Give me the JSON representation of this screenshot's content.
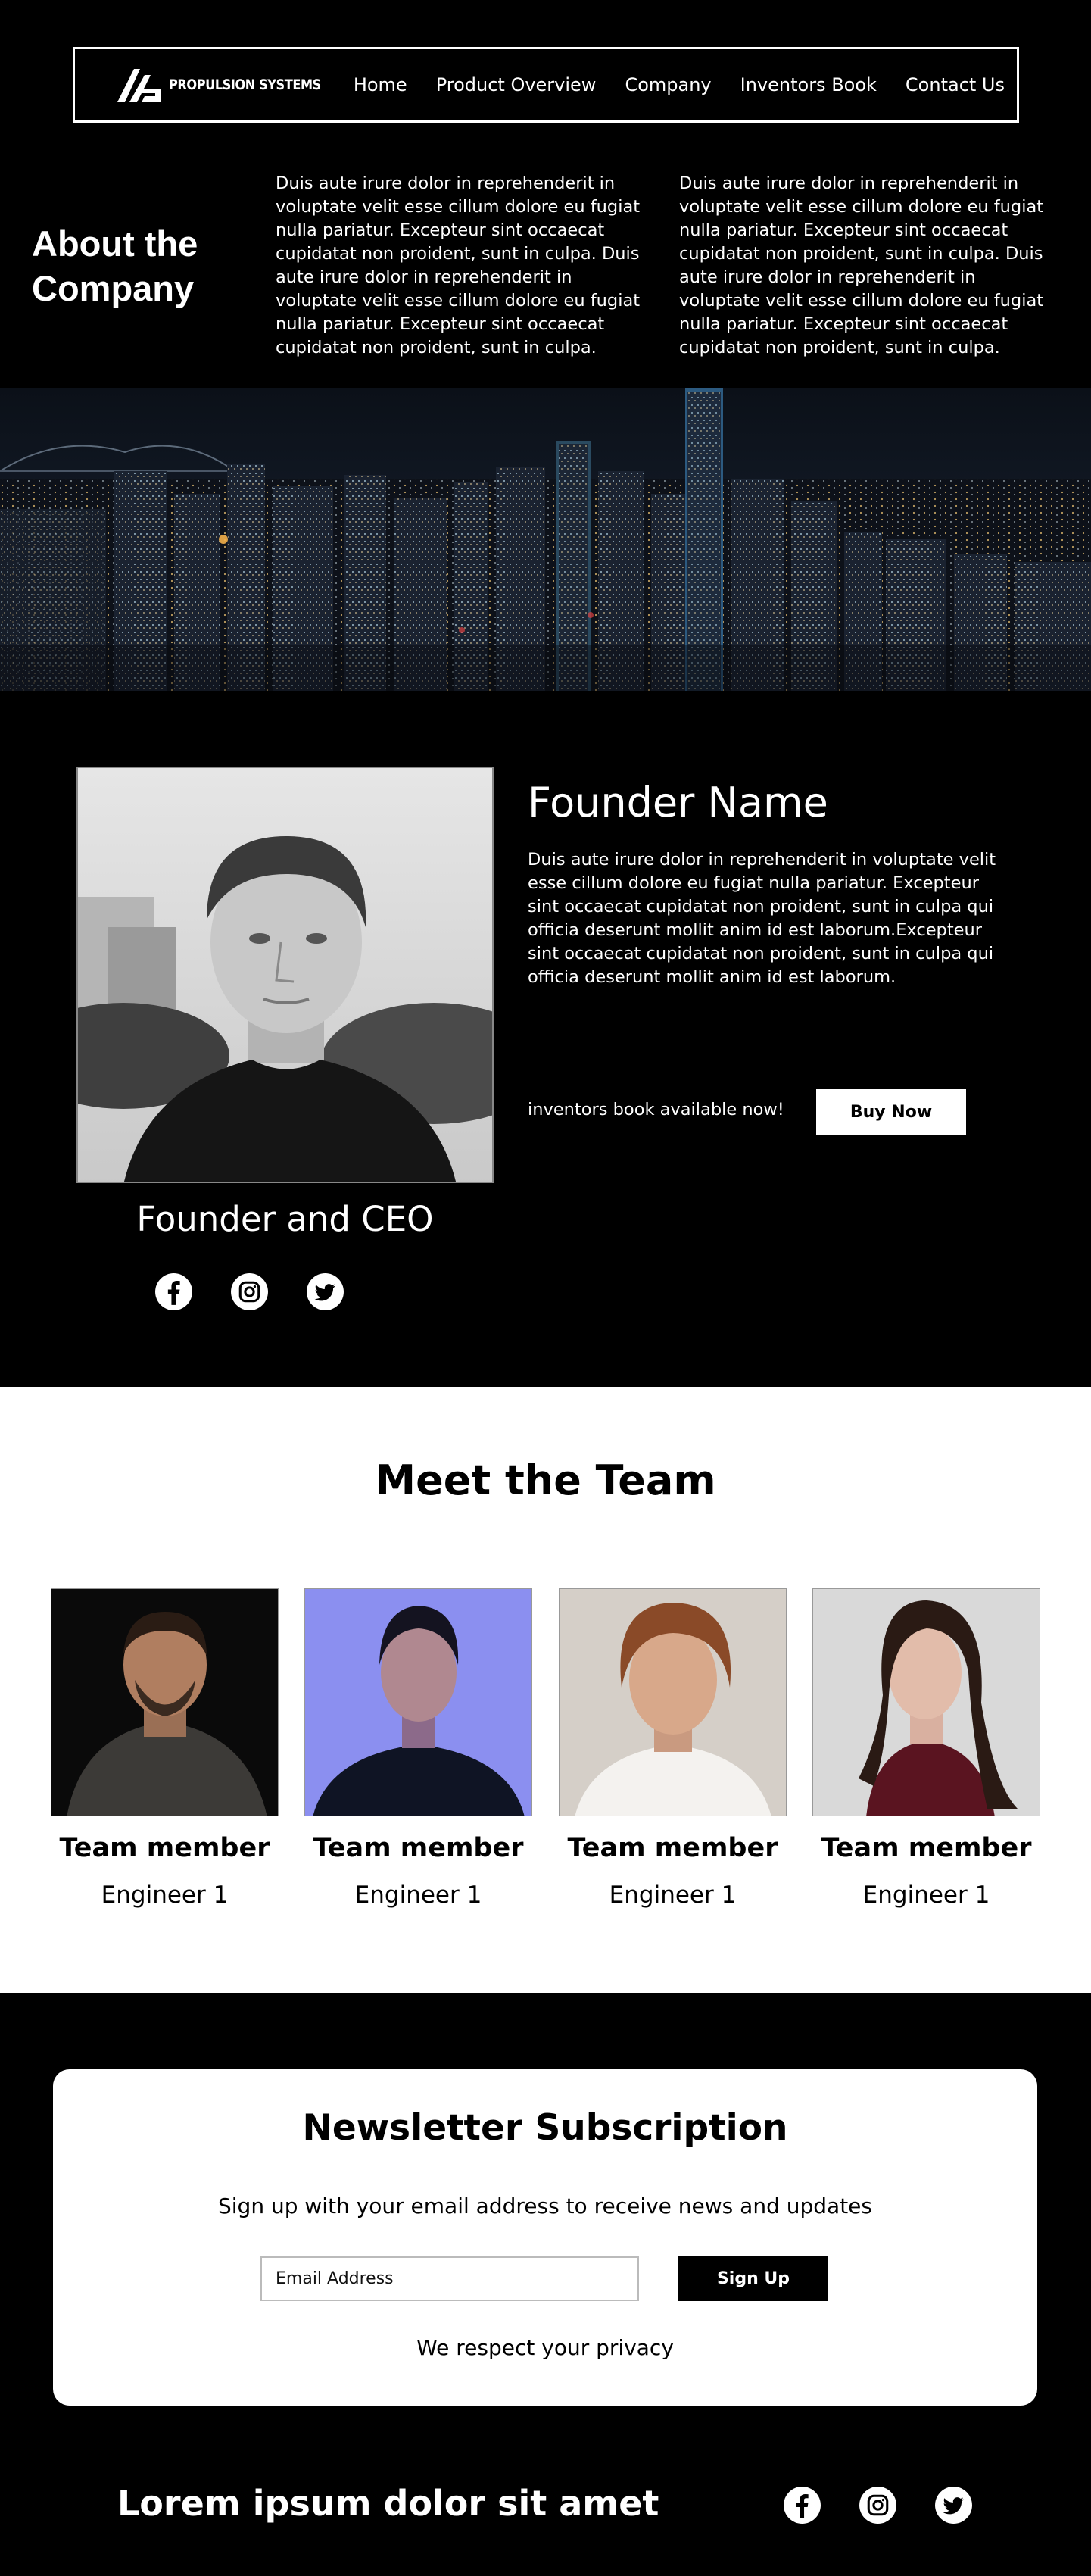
{
  "header": {
    "logo_text": "PROPULSION SYSTEMS",
    "nav": [
      "Home",
      "Product Overview",
      "Company",
      "Inventors Book",
      "Contact Us"
    ]
  },
  "about": {
    "title_line1": "About the",
    "title_line2": "Company",
    "col1": "Duis aute irure dolor in reprehenderit in voluptate velit esse cillum dolore eu fugiat nulla pariatur. Excepteur sint occaecat cupidatat non proident, sunt in culpa. Duis aute irure dolor in reprehenderit in voluptate velit esse cillum dolore eu fugiat nulla pariatur. Excepteur sint occaecat cupidatat non proident, sunt in culpa.",
    "col2": "Duis aute irure dolor in reprehenderit in voluptate velit esse cillum dolore eu fugiat nulla pariatur. Excepteur sint occaecat cupidatat non proident, sunt in culpa. Duis aute irure dolor in reprehenderit in voluptate velit esse cillum dolore eu fugiat nulla pariatur. Excepteur sint occaecat cupidatat non proident, sunt in culpa."
  },
  "founder": {
    "name": "Founder Name",
    "bio": "Duis aute irure dolor in reprehenderit in voluptate velit esse cillum dolore eu fugiat nulla pariatur. Excepteur sint occaecat cupidatat non proident, sunt in culpa qui officia deserunt mollit anim id est laborum.Excepteur sint occaecat cupidatat non proident, sunt in culpa qui officia deserunt mollit anim id est laborum.",
    "book_text": "inventors book available now!",
    "buy_label": "Buy Now",
    "role": "Founder and CEO"
  },
  "social_icons": [
    "facebook-icon",
    "instagram-icon",
    "twitter-icon"
  ],
  "team": {
    "title": "Meet the Team",
    "members": [
      {
        "name": "Team member",
        "role": "Engineer 1"
      },
      {
        "name": "Team member",
        "role": "Engineer 1"
      },
      {
        "name": "Team member",
        "role": "Engineer 1"
      },
      {
        "name": "Team member",
        "role": "Engineer 1"
      }
    ]
  },
  "newsletter": {
    "title": "Newsletter Subscription",
    "subtitle": "Sign up with your email address to receive news and updates",
    "email_placeholder": "Email Address",
    "signup_label": "Sign Up",
    "privacy": "We respect your privacy"
  },
  "footer": {
    "title": "Lorem ipsum dolor sit amet"
  },
  "colors": {
    "background": "#000000",
    "surface": "#ffffff",
    "text_light": "#ffffff",
    "text_dark": "#000000"
  }
}
